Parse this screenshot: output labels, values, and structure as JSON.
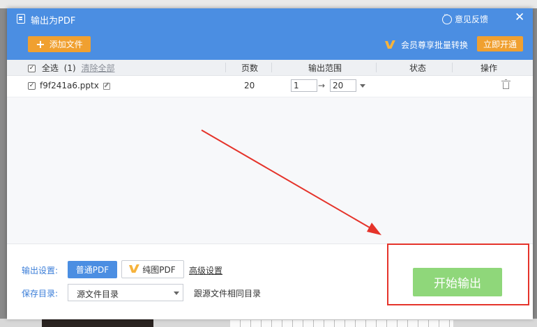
{
  "window": {
    "title": "输出为PDF",
    "feedback_label": "意见反馈",
    "close_glyph": "✕"
  },
  "toolbar": {
    "add_file_label": "添加文件",
    "vip_promo": "会员尊享批量转换",
    "activate_label": "立即开通"
  },
  "table": {
    "select_all_label": "全选",
    "selected_count": "(1)",
    "clear_all_label": "清除全部",
    "headers": {
      "pages": "页数",
      "range": "输出范围",
      "status": "状态",
      "action": "操作"
    },
    "rows": [
      {
        "filename": "f9f241a6.pptx",
        "pages": "20",
        "range_from": "1",
        "range_to": "20",
        "status": "",
        "checked": true
      }
    ]
  },
  "settings": {
    "output_label": "输出设置:",
    "normal_pdf_label": "普通PDF",
    "image_pdf_label": "纯图PDF",
    "advanced_label": "高级设置",
    "save_dir_label": "保存目录:",
    "save_dir_value": "源文件目录",
    "follow_label": "跟源文件相同目录",
    "start_label": "开始输出"
  },
  "colors": {
    "titlebar": "#4b8ee2",
    "accent_orange": "#f0a030",
    "start_button": "#8fd77a",
    "annotation_red": "#e5332a"
  },
  "icons": [
    "document-icon",
    "feedback-icon",
    "close-icon",
    "plus-icon",
    "vip-icon",
    "checkbox-icon",
    "edit-icon",
    "dropdown-caret-icon",
    "trash-icon",
    "arrow-annotation"
  ]
}
